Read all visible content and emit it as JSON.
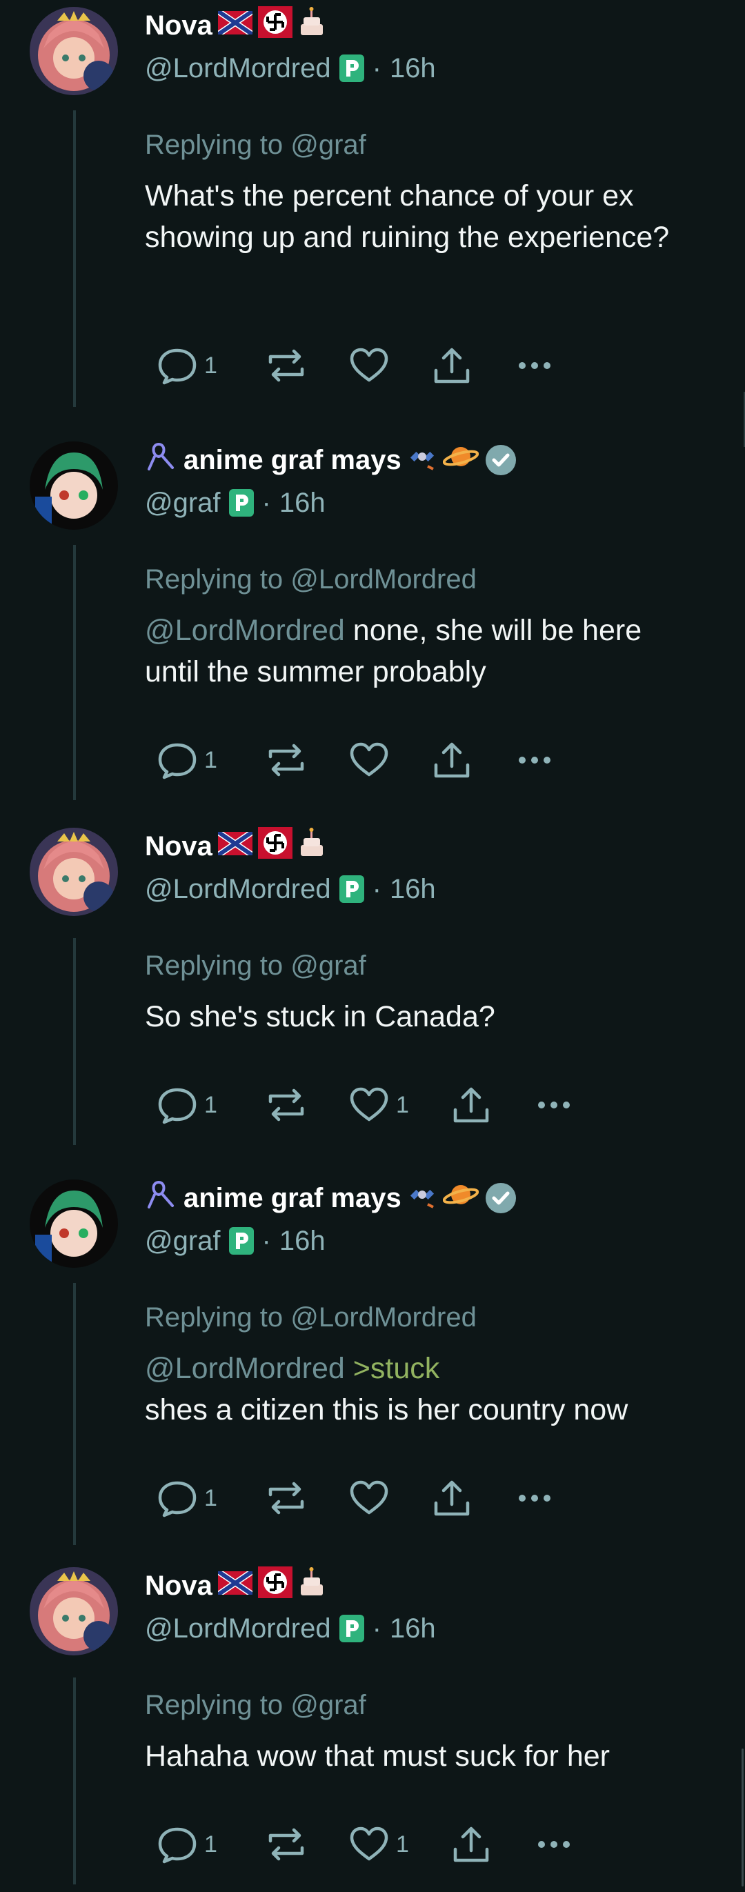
{
  "posts": [
    {
      "author": "Nova",
      "handle": "@LordMordred",
      "time": "16h",
      "replying_label": "Replying to",
      "replying_to": "@graf",
      "body_mention": "",
      "body_green": "",
      "body": "What's the percent chance of your ex showing up and ruining the experience?",
      "reply_count": "1",
      "like_count": ""
    },
    {
      "author": "anime graf mays",
      "handle": "@graf",
      "time": "16h",
      "replying_label": "Replying to",
      "replying_to": "@LordMordred",
      "body_mention": "@LordMordred",
      "body_green": "",
      "body": "none, she will be here until the summer probably",
      "reply_count": "1",
      "like_count": ""
    },
    {
      "author": "Nova",
      "handle": "@LordMordred",
      "time": "16h",
      "replying_label": "Replying to",
      "replying_to": "@graf",
      "body_mention": "",
      "body_green": "",
      "body": "So she's stuck in Canada?",
      "reply_count": "1",
      "like_count": "1"
    },
    {
      "author": "anime graf mays",
      "handle": "@graf",
      "time": "16h",
      "replying_label": "Replying to",
      "replying_to": "@LordMordred",
      "body_mention": "@LordMordred",
      "body_green": ">stuck",
      "body": "shes a citizen this is her country now",
      "reply_count": "1",
      "like_count": ""
    },
    {
      "author": "Nova",
      "handle": "@LordMordred",
      "time": "16h",
      "replying_label": "Replying to",
      "replying_to": "@graf",
      "body_mention": "",
      "body_green": "",
      "body": "Hahaha wow that must suck for her",
      "reply_count": "1",
      "like_count": "1"
    }
  ],
  "separator": "·",
  "icons": {
    "reply": "reply-icon",
    "repost": "repost-icon",
    "like": "heart-icon",
    "share": "share-icon",
    "more": "more-icon",
    "nova_emoji": [
      "confederate-flag-emoji",
      "swastika-emoji",
      "cake-emoji"
    ],
    "graf_emoji": [
      "satellite-emoji",
      "planet-emoji"
    ],
    "graf_prefix": "pride-ribbon-icon",
    "badge": "p-badge-icon",
    "verified": "verified-icon"
  },
  "colors": {
    "background": "#0d1617",
    "muted": "#8fb3b8",
    "mention": "#6f9196",
    "greentext": "#92b360",
    "verified": "#80a9ad",
    "badge": "#2fb37d"
  }
}
